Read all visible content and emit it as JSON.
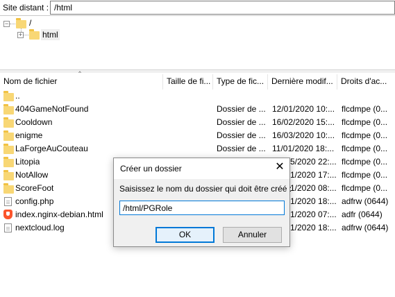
{
  "remote_site": {
    "label": "Site distant :",
    "path": "/html"
  },
  "tree": {
    "root_label": "/",
    "child_label": "html",
    "root_toggle": "−",
    "child_toggle": "+"
  },
  "columns": [
    {
      "label": "Nom de fichier"
    },
    {
      "label": "Taille de fi..."
    },
    {
      "label": "Type de fic..."
    },
    {
      "label": "Dernière modif..."
    },
    {
      "label": "Droits d'ac..."
    }
  ],
  "rows": [
    {
      "icon": "folder-icon",
      "name": "..",
      "type": "",
      "modified": "",
      "perms": ""
    },
    {
      "icon": "folder-icon",
      "name": "404GameNotFound",
      "type": "Dossier de ...",
      "modified": "12/01/2020 10:...",
      "perms": "flcdmpe (0..."
    },
    {
      "icon": "folder-icon",
      "name": "Cooldown",
      "type": "Dossier de ...",
      "modified": "16/02/2020 15:...",
      "perms": "flcdmpe (0..."
    },
    {
      "icon": "folder-icon",
      "name": "enigme",
      "type": "Dossier de ...",
      "modified": "16/03/2020 10:...",
      "perms": "flcdmpe (0..."
    },
    {
      "icon": "folder-icon",
      "name": "LaForgeAuCouteau",
      "type": "Dossier de ...",
      "modified": "11/01/2020 18:...",
      "perms": "flcdmpe (0..."
    },
    {
      "icon": "folder-icon",
      "name": "Litopia",
      "type": "",
      "modified": "5/2020 22:...",
      "perms": "flcdmpe (0..."
    },
    {
      "icon": "folder-icon",
      "name": "NotAllow",
      "type": "",
      "modified": "1/2020 17:...",
      "perms": "flcdmpe (0..."
    },
    {
      "icon": "folder-icon",
      "name": "ScoreFoot",
      "type": "",
      "modified": "1/2020 08:...",
      "perms": "flcdmpe (0..."
    },
    {
      "icon": "file-icon",
      "name": "config.php",
      "type": "",
      "modified": "1/2020 18:...",
      "perms": "adfrw (0644)"
    },
    {
      "icon": "brave-icon",
      "name": "index.nginx-debian.html",
      "type": "",
      "modified": "1/2020 07:...",
      "perms": "adfr (0644)"
    },
    {
      "icon": "file-icon",
      "name": "nextcloud.log",
      "type": "",
      "modified": "1/2020 18:...",
      "perms": "adfrw (0644)"
    }
  ],
  "dialog": {
    "title": "Créer un dossier",
    "close": "✕",
    "prompt": "Saisissez le nom du dossier qui doit être créé :",
    "input_value": "/html/PGRole",
    "ok_label": "OK",
    "cancel_label": "Annuler"
  }
}
